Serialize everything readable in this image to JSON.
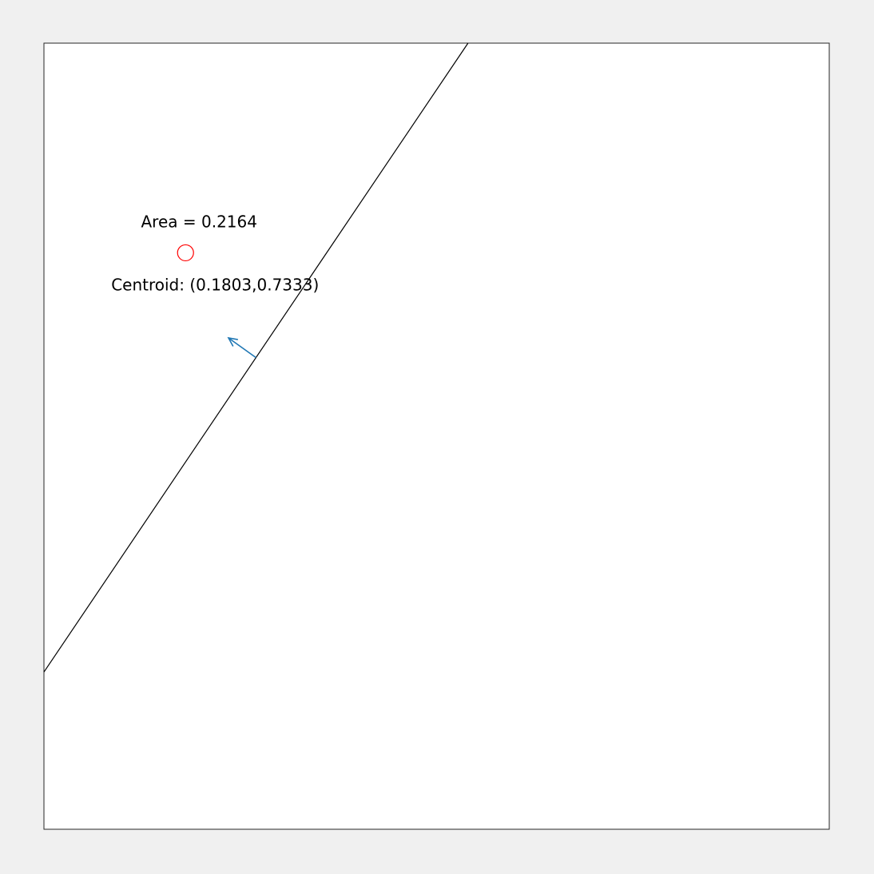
{
  "chart_data": {
    "type": "diagram",
    "xlim": [
      0,
      1
    ],
    "ylim": [
      0,
      1
    ],
    "grid": false,
    "line": {
      "points": [
        [
          0,
          0.2
        ],
        [
          0.54,
          1
        ]
      ],
      "color": "#000000"
    },
    "normal_arrow": {
      "from": [
        0.27,
        0.6
      ],
      "to": [
        0.235,
        0.625
      ],
      "color": "#1f77b4"
    },
    "centroid": {
      "x": 0.1803,
      "y": 0.7333,
      "marker_color": "#ff0000",
      "label": "Centroid: (0.1803,0.7333)"
    },
    "area": {
      "value": 0.2164,
      "label": "Area = 0.2164"
    }
  },
  "colors": {
    "background": "#f0f0f0",
    "axes_face": "#ffffff",
    "axes_edge": "#262626"
  }
}
